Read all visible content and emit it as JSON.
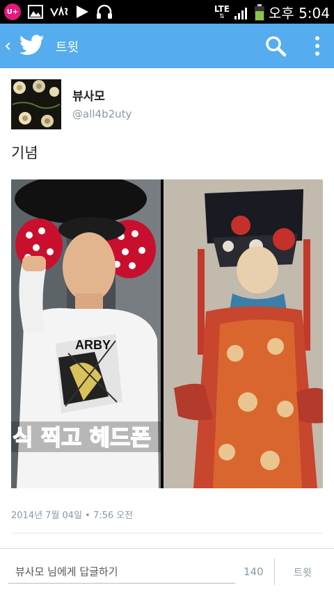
{
  "status_bar": {
    "carrier_badge": "U+",
    "network": "LTE",
    "time": "오후 5:04",
    "icons": [
      "uplus-icon",
      "gallery-icon",
      "vas-icon",
      "play-icon",
      "headphones-icon",
      "data-arrows-icon",
      "signal-icon",
      "battery-icon"
    ]
  },
  "app_bar": {
    "title": "트윗",
    "icons": [
      "back-icon",
      "twitter-bird-icon",
      "search-icon",
      "overflow-menu-icon"
    ]
  },
  "tweet": {
    "display_name": "뷰사모",
    "handle": "@all4b2uty",
    "text": "기념",
    "media_caption": "식 찍고 헤드폰",
    "shirt_text": "ARBY",
    "timestamp": "2014년 7월 04일 • 7:56 오전"
  },
  "reply_bar": {
    "placeholder": "뷰사모 님에게 답글하기",
    "char_count": "140",
    "send_label": "트윗"
  },
  "colors": {
    "app_bar": "#55acee",
    "status_bar": "#000000",
    "meta_text": "#8899a6"
  }
}
